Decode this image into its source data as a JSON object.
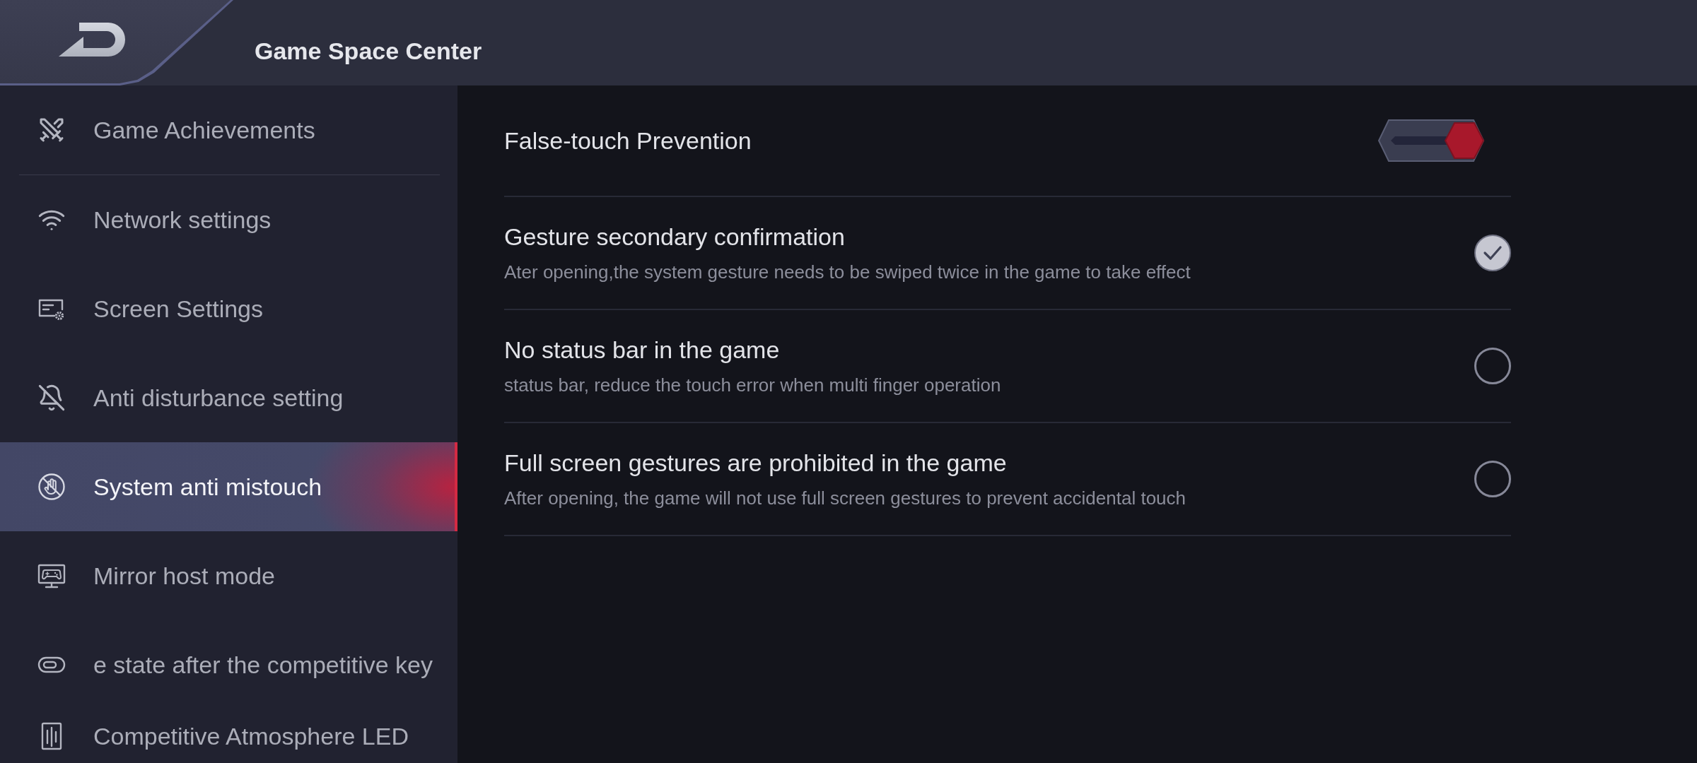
{
  "header": {
    "title": "Game Space Center"
  },
  "sidebar": {
    "sections": [
      {
        "items": [
          {
            "label": "Game Achievements",
            "selected": false
          }
        ]
      },
      {
        "items": [
          {
            "label": "Network settings",
            "selected": false
          },
          {
            "label": "Screen Settings",
            "selected": false
          },
          {
            "label": "Anti disturbance setting",
            "selected": false
          },
          {
            "label": "System anti mistouch",
            "selected": true
          },
          {
            "label": "Mirror host mode",
            "selected": false
          },
          {
            "label": "e state after the competitive key",
            "selected": false
          },
          {
            "label": "Competitive Atmosphere LED",
            "selected": false
          }
        ]
      }
    ]
  },
  "settings": [
    {
      "kind": "switch",
      "title": "False-touch Prevention",
      "on": true
    },
    {
      "kind": "check",
      "title": "Gesture secondary confirmation",
      "description": "Ater opening,the system gesture needs to be swiped twice in the game to take effect",
      "checked": true
    },
    {
      "kind": "check",
      "title": "No status bar in the game",
      "description": "status bar, reduce the touch error when multi finger operation",
      "checked": false
    },
    {
      "kind": "check",
      "title": "Full screen gestures are prohibited in the game",
      "description": "After opening, the game will not use full screen gestures to prevent accidental touch",
      "checked": false
    }
  ]
}
